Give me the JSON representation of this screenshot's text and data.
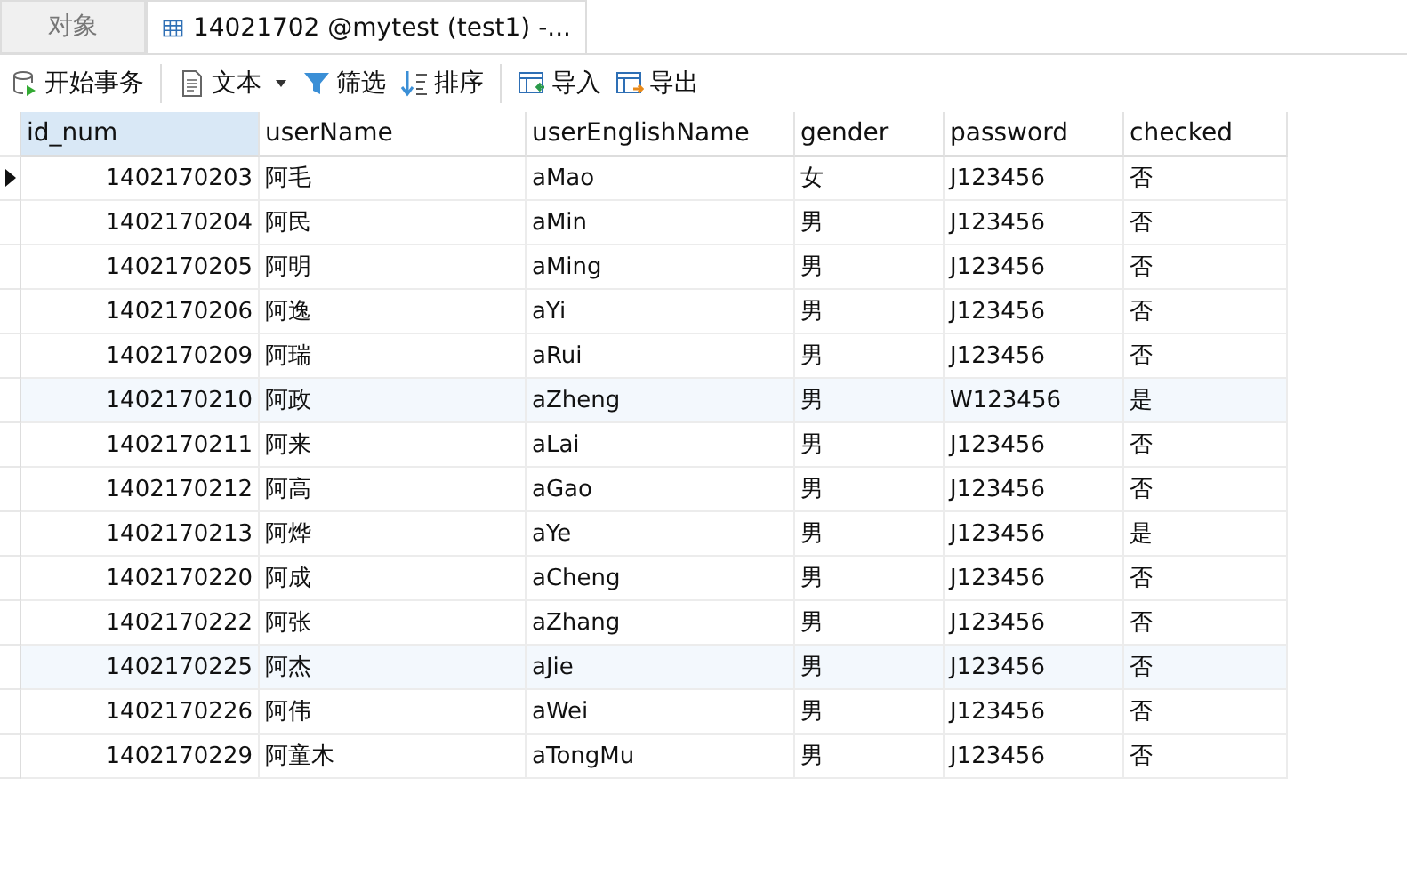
{
  "tabs": [
    {
      "label": "对象",
      "kind": "plain",
      "selected": false
    },
    {
      "label": "14021702 @mytest (test1) -...",
      "kind": "table",
      "selected": true
    }
  ],
  "toolbar_groups": [
    [
      {
        "label": "开始事务",
        "kind": "transaction",
        "dropdown": false
      }
    ],
    [
      {
        "label": "文本",
        "kind": "document",
        "dropdown": true
      },
      {
        "label": "筛选",
        "kind": "filter",
        "dropdown": false
      },
      {
        "label": "排序",
        "kind": "sort",
        "dropdown": false
      }
    ],
    [
      {
        "label": "导入",
        "kind": "import",
        "dropdown": false
      },
      {
        "label": "导出",
        "kind": "export",
        "dropdown": false
      }
    ]
  ],
  "table": {
    "columns": [
      {
        "label": "id_num",
        "selected": true
      },
      {
        "label": "userName",
        "selected": false
      },
      {
        "label": "userEnglishName",
        "selected": false
      },
      {
        "label": "gender",
        "selected": false
      },
      {
        "label": "password",
        "selected": false
      },
      {
        "label": "checked",
        "selected": false
      }
    ],
    "rows": [
      {
        "current": true,
        "highlighted": false,
        "cells": [
          "1402170203",
          "阿毛",
          "aMao",
          "女",
          "J123456",
          "否"
        ]
      },
      {
        "current": false,
        "highlighted": false,
        "cells": [
          "1402170204",
          "阿民",
          "aMin",
          "男",
          "J123456",
          "否"
        ]
      },
      {
        "current": false,
        "highlighted": false,
        "cells": [
          "1402170205",
          "阿明",
          "aMing",
          "男",
          "J123456",
          "否"
        ]
      },
      {
        "current": false,
        "highlighted": false,
        "cells": [
          "1402170206",
          "阿逸",
          "aYi",
          "男",
          "J123456",
          "否"
        ]
      },
      {
        "current": false,
        "highlighted": false,
        "cells": [
          "1402170209",
          "阿瑞",
          "aRui",
          "男",
          "J123456",
          "否"
        ]
      },
      {
        "current": false,
        "highlighted": true,
        "cells": [
          "1402170210",
          "阿政",
          "aZheng",
          "男",
          "W123456",
          "是"
        ]
      },
      {
        "current": false,
        "highlighted": false,
        "cells": [
          "1402170211",
          "阿来",
          "aLai",
          "男",
          "J123456",
          "否"
        ]
      },
      {
        "current": false,
        "highlighted": false,
        "cells": [
          "1402170212",
          "阿高",
          "aGao",
          "男",
          "J123456",
          "否"
        ]
      },
      {
        "current": false,
        "highlighted": false,
        "cells": [
          "1402170213",
          "阿烨",
          "aYe",
          "男",
          "J123456",
          "是"
        ]
      },
      {
        "current": false,
        "highlighted": false,
        "cells": [
          "1402170220",
          "阿成",
          "aCheng",
          "男",
          "J123456",
          "否"
        ]
      },
      {
        "current": false,
        "highlighted": false,
        "cells": [
          "1402170222",
          "阿张",
          "aZhang",
          "男",
          "J123456",
          "否"
        ]
      },
      {
        "current": false,
        "highlighted": true,
        "cells": [
          "1402170225",
          "阿杰",
          "aJie",
          "男",
          "J123456",
          "否"
        ]
      },
      {
        "current": false,
        "highlighted": false,
        "cells": [
          "1402170226",
          "阿伟",
          "aWei",
          "男",
          "J123456",
          "否"
        ]
      },
      {
        "current": false,
        "highlighted": false,
        "cells": [
          "1402170229",
          "阿童木",
          "aTongMu",
          "男",
          "J123456",
          "否"
        ]
      }
    ]
  }
}
